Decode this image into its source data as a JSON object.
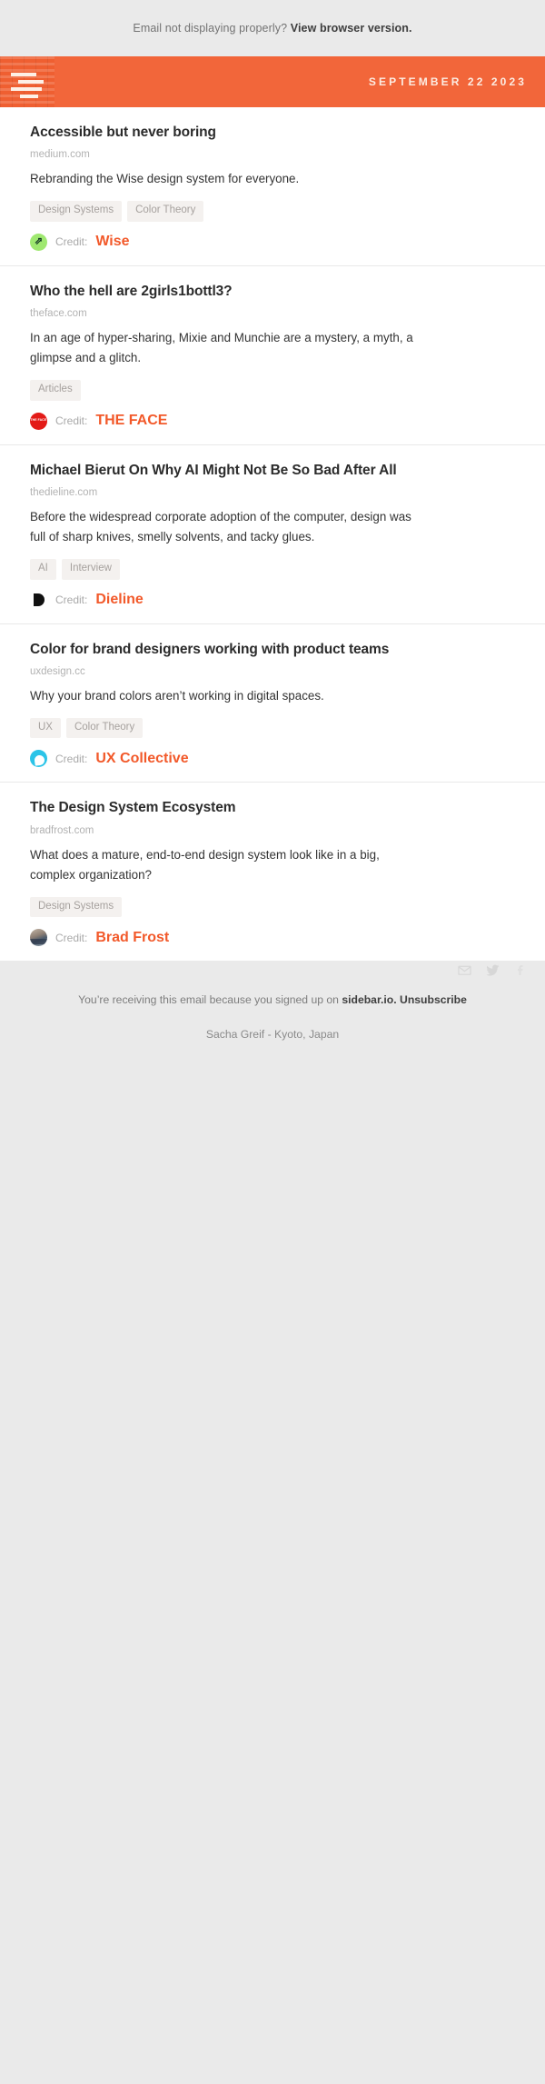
{
  "preheader": {
    "text": "Email not displaying properly?",
    "link_label": "View browser version."
  },
  "masthead": {
    "logo_name": "sidebar-logo",
    "date": "SEPTEMBER 22 2023",
    "accent_color": "#f2663a"
  },
  "social": {
    "email_label": "Share by email",
    "twitter_label": "Share on Twitter",
    "facebook_label": "Share on Facebook"
  },
  "credit_prefix": "Credit:",
  "articles": [
    {
      "title": "Accessible but never boring",
      "source": "medium.com",
      "description": "Rebranding the Wise design system for everyone.",
      "tags": [
        "Design Systems",
        "Color Theory"
      ],
      "credit_name": "Wise",
      "avatar": "wise-avatar",
      "avatar_glyph": "⇗"
    },
    {
      "title": "Who the hell are 2girls1bottl3?",
      "source": "theface.com",
      "description": "In an age of hyper-sharing, Mixie and Munchie are a mystery, a myth, a glimpse and a glitch.",
      "tags": [
        "Articles"
      ],
      "credit_name": "THE FACE",
      "avatar": "the-face-avatar",
      "avatar_glyph": "THE FACE"
    },
    {
      "title": "Michael Bierut On Why AI Might Not Be So Bad After All",
      "source": "thedieline.com",
      "description": "Before the widespread corporate adoption of the computer, design was full of sharp knives, smelly solvents, and tacky glues.",
      "tags": [
        "AI",
        "Interview"
      ],
      "credit_name": "Dieline",
      "avatar": "dieline-avatar",
      "avatar_glyph": ""
    },
    {
      "title": "Color for brand designers working with product teams",
      "source": "uxdesign.cc",
      "description": "Why your brand colors aren’t working in digital spaces.",
      "tags": [
        "UX",
        "Color Theory"
      ],
      "credit_name": "UX Collective",
      "avatar": "ux-collective-avatar",
      "avatar_glyph": ""
    },
    {
      "title": "The Design System Ecosystem",
      "source": "bradfrost.com",
      "description": "What does a mature, end-to-end design system look like in a big, complex organization?",
      "tags": [
        "Design Systems"
      ],
      "credit_name": "Brad Frost",
      "avatar": "brad-frost-avatar",
      "avatar_glyph": ""
    }
  ],
  "footer": {
    "line1_prefix": "You’re receiving this email because you signed up on",
    "site": "sidebar.io",
    "period": ".",
    "unsubscribe": "Unsubscribe",
    "line2": "Sacha Greif - Kyoto, Japan"
  }
}
